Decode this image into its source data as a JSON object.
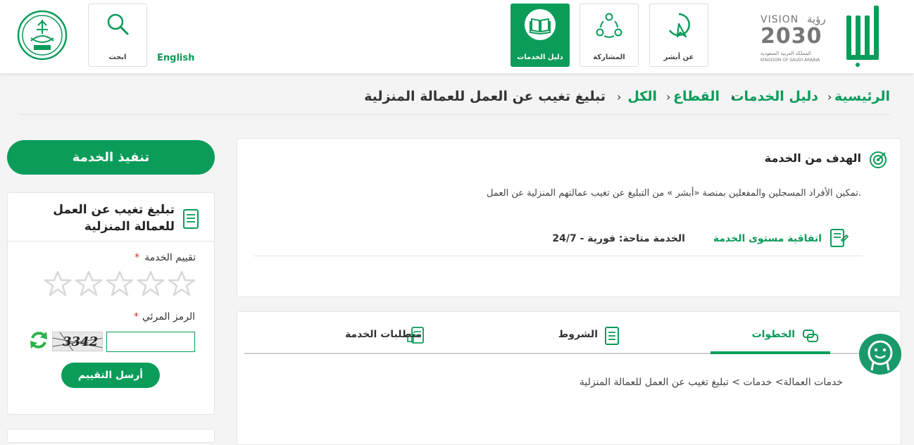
{
  "header": {
    "nav_items": [
      {
        "label": "عن أبشر",
        "icon": "absher-logo-icon"
      },
      {
        "label": "المشاركة",
        "icon": "participation-icon"
      },
      {
        "label": "دليل الخدمات",
        "icon": "book-icon"
      }
    ],
    "language_link": "English",
    "search_label": "ابحث",
    "vision": {
      "brand": "VISION",
      "arabic": "رؤية",
      "year": "2030",
      "kingdom_ar": "المملكة العربية السعودية",
      "kingdom_en": "KINGDOM OF SAUDI ARABIA"
    }
  },
  "breadcrumb": {
    "items": [
      "الرئيسية",
      "دليل الخدمات",
      "القطاع",
      "الكل"
    ],
    "current": "تبليغ تغيب عن العمل للعمالة المنزلية"
  },
  "goal": {
    "title": "الهدف من الخدمة",
    "description": "تمكين الأفراد المسجلين والمفعلين بمنصة «أبشر » من التبليغ عن تغيب عمالتهم المنزلية عن العمل.",
    "sla_label": "اتفاقية مستوى الخدمة",
    "availability": "الخدمة متاحة: فورية - 24/7"
  },
  "tabs": {
    "items": [
      "الخطوات",
      "الشروط",
      "متطلبات الخدمة"
    ],
    "active": "الخطوات",
    "steps_path": "خدمات العمالة> خدمات > تبليغ تغيب عن العمل للعمالة المنزلية"
  },
  "sidebar": {
    "execute_button": "تنفيذ الخدمة",
    "service_title": "تبليغ تغيب عن العمل للعمالة المنزلية",
    "rating_label": "تقييم الخدمة",
    "stars": 5,
    "rating_value": 0,
    "captcha_label": "الرمز المرئي",
    "captcha_text": "3342",
    "required_mark": "*",
    "submit_rating": "أرسل التقييم"
  },
  "colors": {
    "brand_green": "#0b9c5a",
    "star_outline": "#d8d8d8"
  }
}
